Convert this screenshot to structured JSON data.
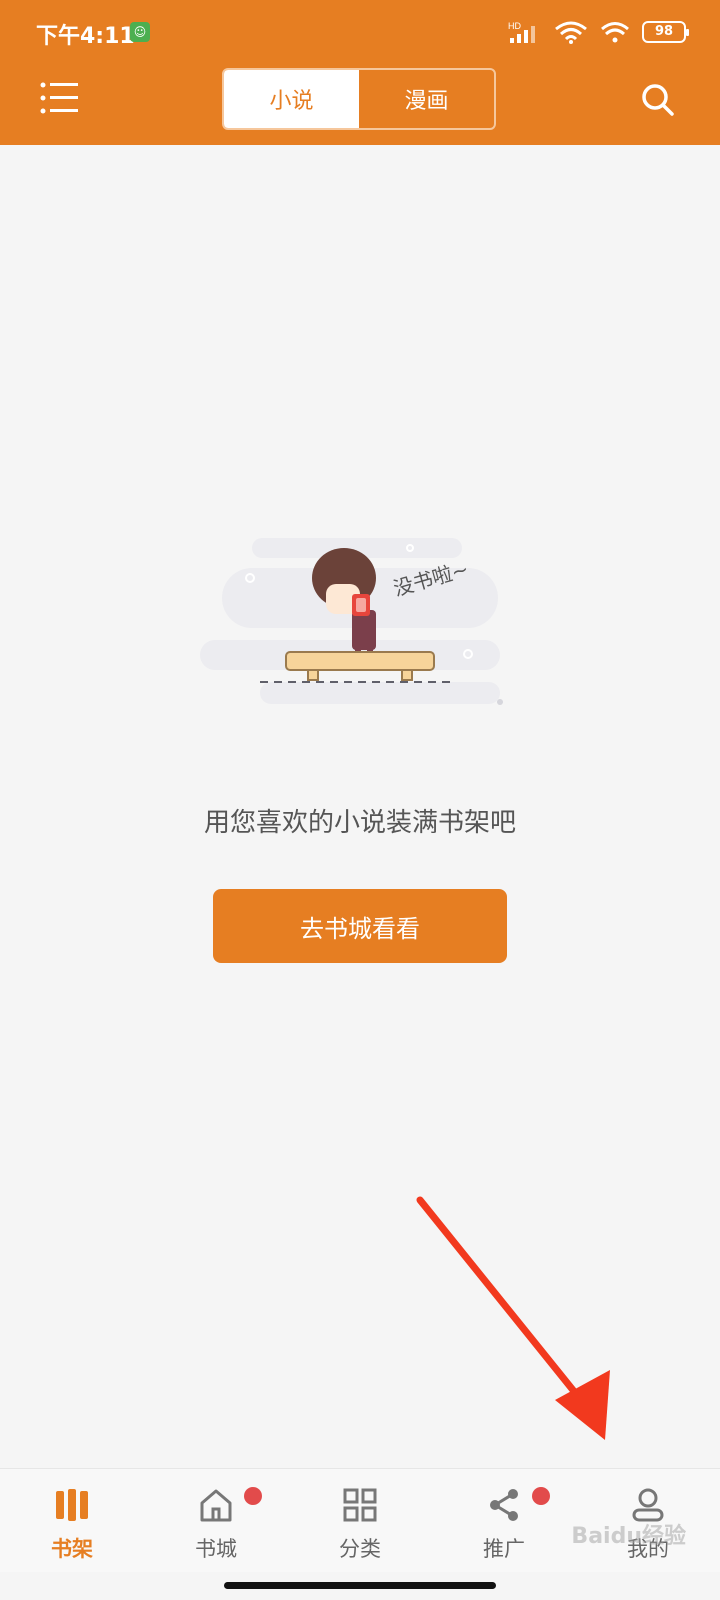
{
  "status_bar": {
    "time": "下午4:11",
    "battery": "98",
    "network_badge": "HD"
  },
  "header": {
    "menu_icon": "menu-icon",
    "search_icon": "search-icon",
    "tabs": [
      {
        "label": "小说",
        "active": true
      },
      {
        "label": "漫画",
        "active": false
      }
    ]
  },
  "empty_state": {
    "illustration_text": "没书啦~",
    "message": "用您喜欢的小说装满书架吧",
    "button_label": "去书城看看"
  },
  "bottom_nav": {
    "items": [
      {
        "label": "书架",
        "icon": "bookshelf-icon",
        "active": true,
        "badge": false
      },
      {
        "label": "书城",
        "icon": "home-icon",
        "active": false,
        "badge": true
      },
      {
        "label": "分类",
        "icon": "category-icon",
        "active": false,
        "badge": false
      },
      {
        "label": "推广",
        "icon": "share-icon",
        "active": false,
        "badge": true
      },
      {
        "label": "我的",
        "icon": "profile-icon",
        "active": false,
        "badge": false
      }
    ]
  },
  "watermark": "Baidu经验",
  "colors": {
    "accent": "#e67e22",
    "badge": "#e24b4b",
    "arrow": "#f2391e"
  }
}
